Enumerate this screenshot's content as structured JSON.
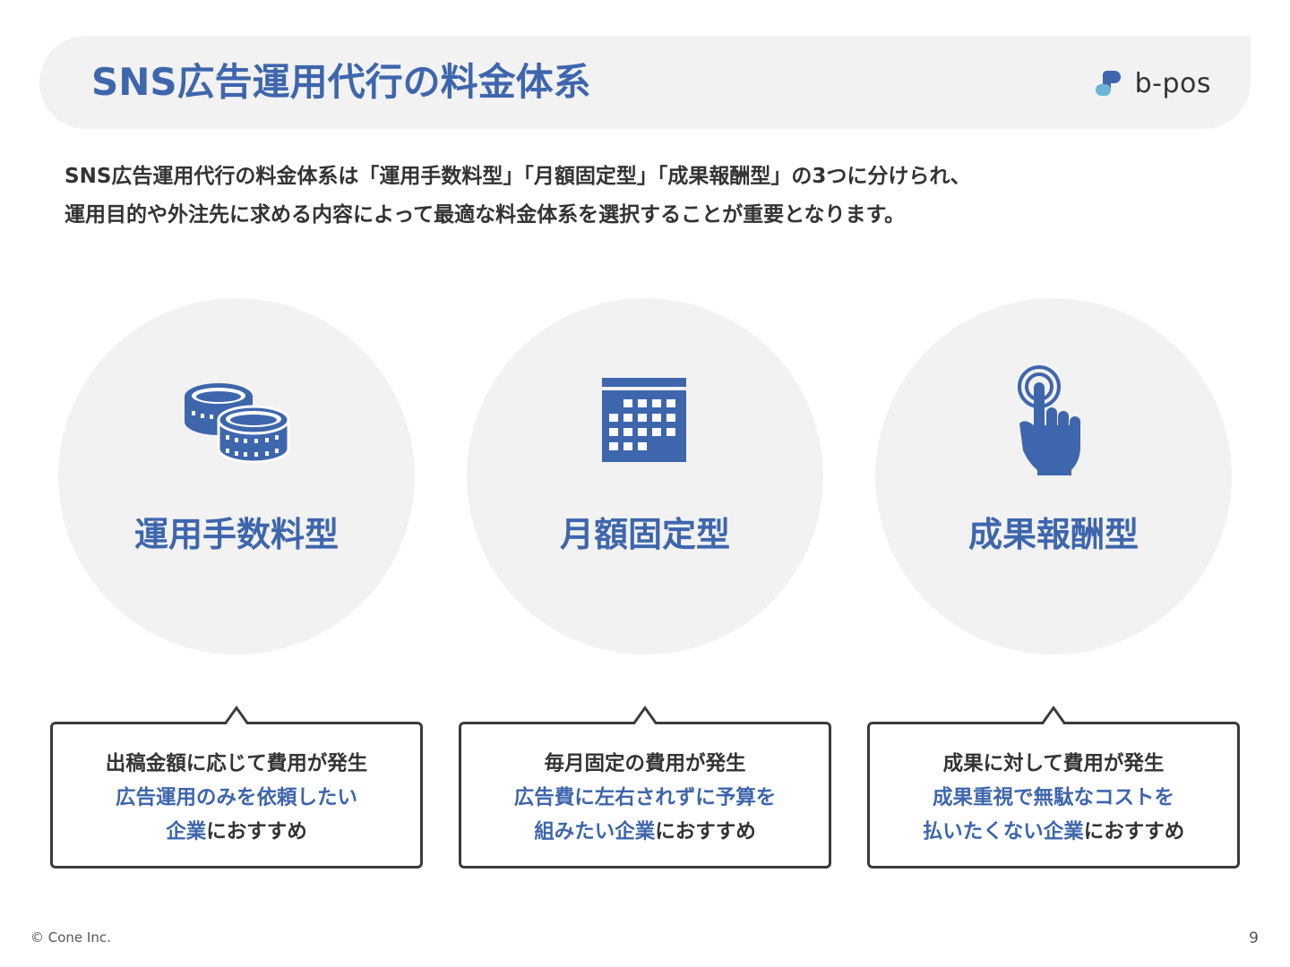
{
  "header": {
    "title": "SNS広告運用代行の料金体系",
    "logo_text": "b-pos",
    "colors": {
      "accent": "#3e66ad",
      "logo_dark": "#3e66ad",
      "logo_light": "#6bb3d9"
    }
  },
  "intro": {
    "line1": "SNS広告運用代行の料金体系は「運用手数料型」「月額固定型」「成果報酬型」の3つに分けられ、",
    "line2": "運用目的や外注先に求める内容によって最適な料金体系を選択することが重要となります。"
  },
  "plans": [
    {
      "icon": "coins-icon",
      "label": "運用手数料型",
      "line1": "出稿金額に応じて費用が発生",
      "line2_accent": "広告運用のみを依頼したい",
      "line3_accent": "企業",
      "line3_rest": "におすすめ"
    },
    {
      "icon": "calendar-icon",
      "label": "月額固定型",
      "line1": "毎月固定の費用が発生",
      "line2_accent": "広告費に左右されずに予算を",
      "line3_accent": "組みたい企業",
      "line3_rest": "におすすめ"
    },
    {
      "icon": "tap-hand-icon",
      "label": "成果報酬型",
      "line1": "成果に対して費用が発生",
      "line2_accent": "成果重視で無駄なコストを",
      "line3_accent": "払いたくない企業",
      "line3_rest": "におすすめ"
    }
  ],
  "footer": {
    "copyright": "© Cone Inc.",
    "page_number": "9"
  }
}
